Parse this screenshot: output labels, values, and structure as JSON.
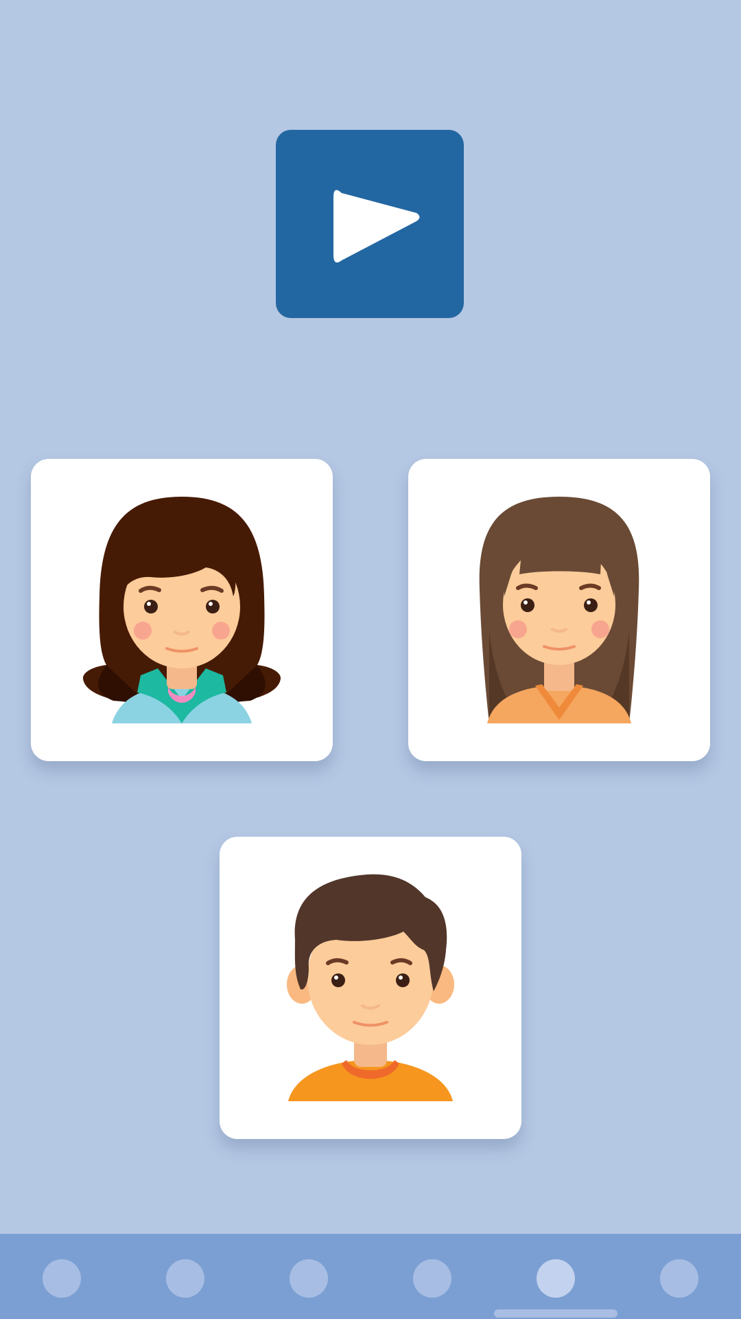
{
  "play_button": {
    "icon": "play-icon",
    "color": "#2367a2"
  },
  "characters": [
    {
      "name": "girl-dark-hair",
      "hair_color": "#461b05",
      "shirt_color": "#8bd3e3"
    },
    {
      "name": "girl-brown-hair-bangs",
      "hair_color": "#6a4a35",
      "shirt_color": "#f5a65f"
    },
    {
      "name": "boy-brown-hair",
      "hair_color": "#52362a",
      "shirt_color": "#f6961f"
    }
  ],
  "page_indicator": {
    "count": 6,
    "active_index": 4
  },
  "colors": {
    "background": "#b4c7e3",
    "bottom_bar": "#7b9fd3",
    "dot": "#a7bde3",
    "dot_active": "#c3d2ee",
    "skin": "#fccc9a"
  }
}
